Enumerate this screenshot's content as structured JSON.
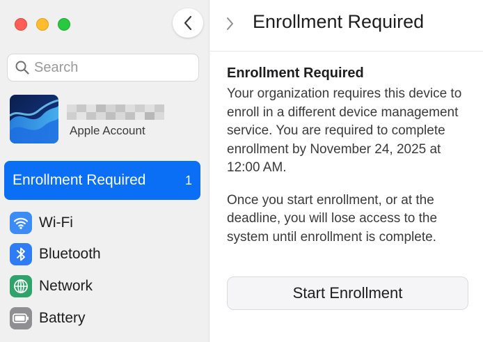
{
  "window": {
    "controls": [
      "close",
      "minimize",
      "zoom"
    ]
  },
  "sidebar": {
    "search": {
      "placeholder": "Search",
      "value": ""
    },
    "account": {
      "label": "Apple Account"
    },
    "selected": {
      "label": "Enrollment Required",
      "badge": "1"
    },
    "items": [
      {
        "label": "Wi-Fi",
        "icon": "wifi-icon",
        "color": "#3b8cf6"
      },
      {
        "label": "Bluetooth",
        "icon": "bluetooth-icon",
        "color": "#2f7df6"
      },
      {
        "label": "Network",
        "icon": "network-globe-icon",
        "color": "#2fa46a"
      },
      {
        "label": "Battery",
        "icon": "battery-icon",
        "color": "#8e8e93"
      }
    ]
  },
  "main": {
    "title": "Enrollment Required",
    "section_title": "Enrollment Required",
    "paragraph1": "Your organization requires this device to enroll in a different device management service. You are required to complete enrollment by November 24, 2025 at 12:00 AM.",
    "paragraph2": "Once you start enrollment, or at the deadline, you will lose access to the system until enrollment is complete.",
    "button": "Start Enrollment"
  },
  "colors": {
    "accent": "#0a6ff5",
    "sidebar_bg": "#f1f0f0"
  }
}
